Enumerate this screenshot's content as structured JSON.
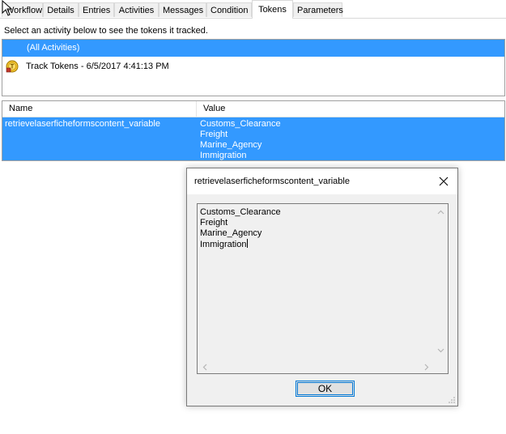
{
  "tabs": [
    {
      "label": "Workflow",
      "active": false
    },
    {
      "label": "Details",
      "active": false
    },
    {
      "label": "Entries",
      "active": false
    },
    {
      "label": "Activities",
      "active": false
    },
    {
      "label": "Messages",
      "active": false
    },
    {
      "label": "Condition",
      "active": false
    },
    {
      "label": "Tokens",
      "active": true
    },
    {
      "label": "Parameters",
      "active": false
    }
  ],
  "instruction": "Select an activity below to see the tokens it tracked.",
  "activities": {
    "selected_label": "(All Activities)",
    "items": [
      {
        "label": "Track Tokens - 6/5/2017 4:41:13 PM",
        "icon": "track-tokens-icon"
      }
    ]
  },
  "grid": {
    "columns": {
      "name": "Name",
      "value": "Value"
    },
    "rows": [
      {
        "name": "retrievelaserficheformscontent_variable",
        "values": [
          "Customs_Clearance",
          "Freight",
          "Marine_Agency",
          "Immigration"
        ]
      }
    ]
  },
  "dialog": {
    "title": "retrievelaserficheformscontent_variable",
    "lines": [
      "Customs_Clearance",
      "Freight",
      "Marine_Agency",
      "Immigration"
    ],
    "ok_label": "OK"
  },
  "colors": {
    "selection": "#3399ff",
    "dialog_background": "#f0f0f0",
    "focus_border": "#0078d7"
  }
}
